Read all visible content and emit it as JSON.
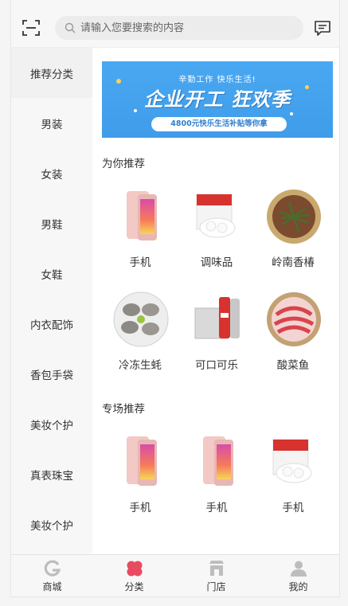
{
  "search": {
    "placeholder": "请输入您要搜索的内容"
  },
  "sidebar": {
    "items": [
      {
        "label": "推荐分类",
        "active": true
      },
      {
        "label": "男装"
      },
      {
        "label": "女装"
      },
      {
        "label": "男鞋"
      },
      {
        "label": "女鞋"
      },
      {
        "label": "内衣配饰"
      },
      {
        "label": "香包手袋"
      },
      {
        "label": "美妆个护"
      },
      {
        "label": "真表珠宝"
      },
      {
        "label": "美妆个护"
      }
    ]
  },
  "banner": {
    "top_text": "辛勤工作 快乐生活!",
    "main_text": "企业开工 狂欢季",
    "sub_text": "4800元快乐生活补贴等你拿",
    "color": "#3f9ce9"
  },
  "recommend": {
    "title": "为你推荐",
    "items": [
      {
        "name": "手机",
        "icon": "phone-image"
      },
      {
        "name": "调味品",
        "icon": "sugar-box-image"
      },
      {
        "name": "岭南香椿",
        "icon": "toona-basket-image"
      },
      {
        "name": "冷冻生蚝",
        "icon": "oyster-plate-image"
      },
      {
        "name": "可口可乐",
        "icon": "cola-pack-image"
      },
      {
        "name": "酸菜鱼",
        "icon": "fish-plate-image"
      }
    ]
  },
  "special": {
    "title": "专场推荐",
    "items": [
      {
        "name": "手机",
        "icon": "phone-image"
      },
      {
        "name": "手机",
        "icon": "phone-image"
      },
      {
        "name": "手机",
        "icon": "sugar-box-image"
      }
    ]
  },
  "tabbar": {
    "items": [
      {
        "label": "商城",
        "icon": "mall-icon"
      },
      {
        "label": "分类",
        "icon": "category-icon",
        "active": true
      },
      {
        "label": "门店",
        "icon": "store-icon"
      },
      {
        "label": "我的",
        "icon": "user-icon"
      }
    ],
    "active_color": "#e84a5f"
  }
}
